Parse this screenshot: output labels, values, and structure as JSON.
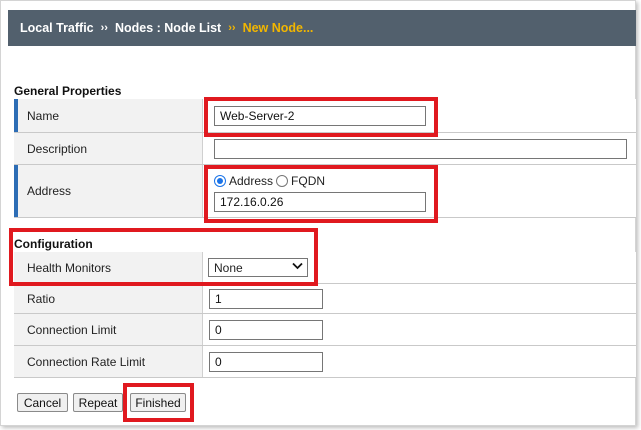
{
  "breadcrumb": {
    "item1": "Local Traffic",
    "sep": "››",
    "item2": "Nodes : Node List",
    "current": "New Node..."
  },
  "general": {
    "title": "General Properties",
    "name_label": "Name",
    "name_value": "Web-Server-2",
    "description_label": "Description",
    "description_value": "",
    "address_label": "Address",
    "address_option": "Address",
    "fqdn_option": "FQDN",
    "address_value": "172.16.0.26"
  },
  "configuration": {
    "title": "Configuration",
    "health_label": "Health Monitors",
    "health_value": "None",
    "ratio_label": "Ratio",
    "ratio_value": "1",
    "conn_limit_label": "Connection Limit",
    "conn_limit_value": "0",
    "conn_rate_label": "Connection Rate Limit",
    "conn_rate_value": "0"
  },
  "buttons": {
    "cancel": "Cancel",
    "repeat": "Repeat",
    "finished": "Finished"
  },
  "colors": {
    "highlight": "#e0191f",
    "header_bg": "#52606d",
    "current_crumb": "#f2b600",
    "required_bar": "#2d6db5"
  }
}
